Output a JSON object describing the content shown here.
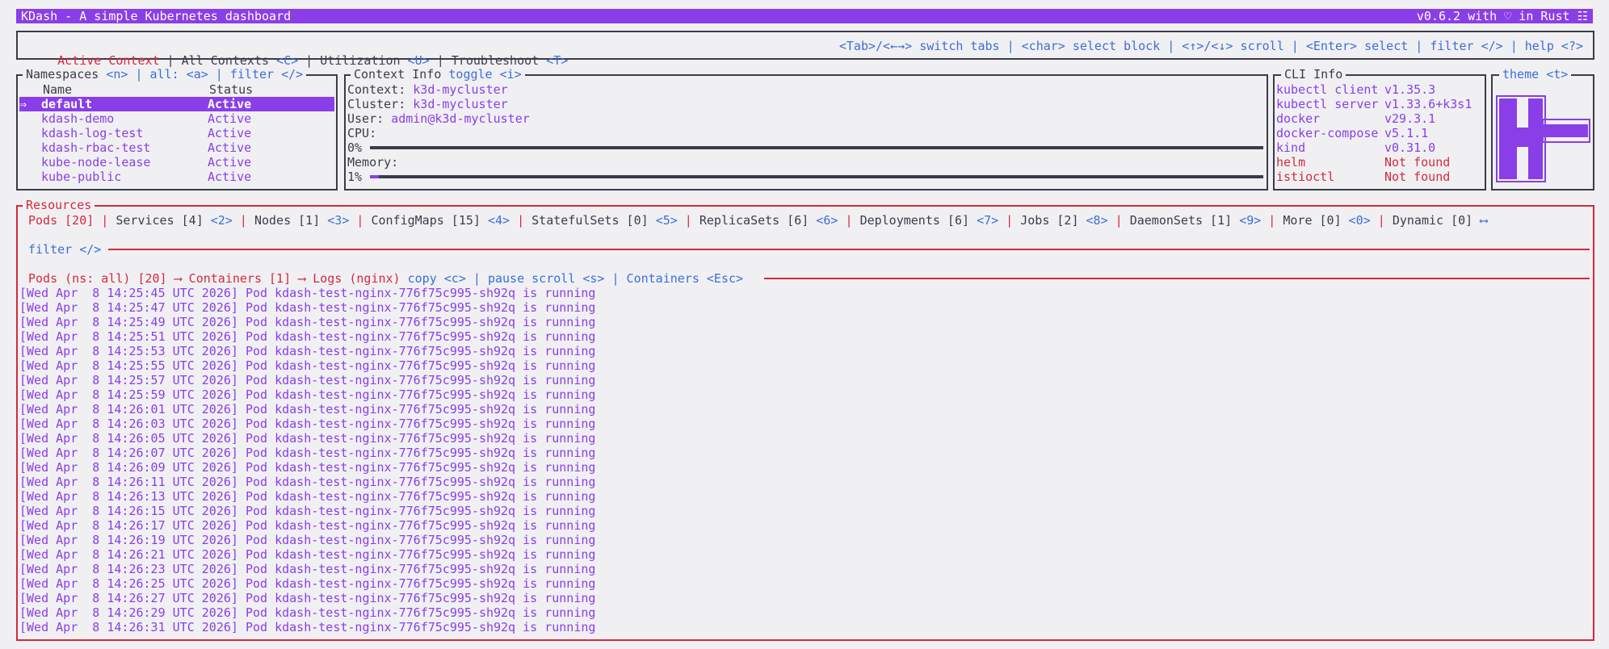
{
  "titlebar": {
    "title": "KDash - A simple Kubernetes dashboard",
    "version": "v0.6.2 with ♡ in Rust ☷"
  },
  "top_tabs": [
    {
      "label": "Active Context",
      "key": ""
    },
    {
      "label": "All Contexts",
      "key": "<C>"
    },
    {
      "label": "Utilization",
      "key": "<U>"
    },
    {
      "label": "Troubleshoot",
      "key": "<T>"
    }
  ],
  "help_bar": "<Tab>/<←→> switch tabs | <char> select block | <↑>/<↓> scroll | <Enter> select | filter </> | help <?>",
  "namespaces": {
    "title": "Namespaces",
    "key_n": "<n>",
    "all_label": "all:",
    "key_a": "<a>",
    "filter_label": "filter",
    "key_filter": "</>",
    "col_name": "Name",
    "col_status": "Status",
    "selected_marker": "⇒",
    "rows": [
      {
        "name": "default",
        "status": "Active"
      },
      {
        "name": "kdash-demo",
        "status": "Active"
      },
      {
        "name": "kdash-log-test",
        "status": "Active"
      },
      {
        "name": "kdash-rbac-test",
        "status": "Active"
      },
      {
        "name": "kube-node-lease",
        "status": "Active"
      },
      {
        "name": "kube-public",
        "status": "Active"
      }
    ]
  },
  "context_info": {
    "title": "Context Info",
    "toggle_label": "toggle",
    "key_i": "<i>",
    "context_label": "Context:",
    "context_value": "k3d-mycluster",
    "cluster_label": "Cluster:",
    "cluster_value": "k3d-mycluster",
    "user_label": "User:",
    "user_value": "admin@k3d-mycluster",
    "cpu_label": "CPU:",
    "cpu_value": "0%",
    "cpu_fraction": 0.0,
    "memory_label": "Memory:",
    "memory_value": "1%",
    "memory_fraction": 0.01
  },
  "cli_info": {
    "title": "CLI Info",
    "rows": [
      {
        "name": "kubectl client",
        "version": "v1.35.3",
        "found": true
      },
      {
        "name": "kubectl server",
        "version": "v1.33.6+k3s1",
        "found": true
      },
      {
        "name": "docker",
        "version": "v29.3.1",
        "found": true
      },
      {
        "name": "docker-compose",
        "version": "v5.1.1",
        "found": true
      },
      {
        "name": "kind",
        "version": "v0.31.0",
        "found": true
      },
      {
        "name": "helm",
        "version": "Not found",
        "found": false
      },
      {
        "name": "istioctl",
        "version": "Not found",
        "found": false
      }
    ]
  },
  "theme": {
    "title": "theme",
    "key": "<t>"
  },
  "resources": {
    "title": "Resources",
    "tabs": [
      {
        "label": "Pods [20]",
        "key": ""
      },
      {
        "label": "Services [4]",
        "key": "<2>"
      },
      {
        "label": "Nodes [1]",
        "key": "<3>"
      },
      {
        "label": "ConfigMaps [15]",
        "key": "<4>"
      },
      {
        "label": "StatefulSets [0]",
        "key": "<5>"
      },
      {
        "label": "ReplicaSets [6]",
        "key": "<6>"
      },
      {
        "label": "Deployments [6]",
        "key": "<7>"
      },
      {
        "label": "Jobs [2]",
        "key": "<8>"
      },
      {
        "label": "DaemonSets [1]",
        "key": "<9>"
      },
      {
        "label": "More [0]",
        "key": "<0>"
      },
      {
        "label": "Dynamic [0]",
        "key": "⟷"
      }
    ],
    "filter_label": "filter",
    "filter_key": "</>"
  },
  "logs": {
    "breadcrumb": "Pods (ns: all) [20] ⟶ Containers [1] ⟶ Logs (nginx)",
    "copy_label": "copy",
    "copy_key": "<c>",
    "pause_label": "pause scroll",
    "pause_key": "<s>",
    "containers_label": "Containers",
    "containers_key": "<Esc>",
    "lines": [
      "[Wed Apr  8 14:25:45 UTC 2026] Pod kdash-test-nginx-776f75c995-sh92q is running",
      "[Wed Apr  8 14:25:47 UTC 2026] Pod kdash-test-nginx-776f75c995-sh92q is running",
      "[Wed Apr  8 14:25:49 UTC 2026] Pod kdash-test-nginx-776f75c995-sh92q is running",
      "[Wed Apr  8 14:25:51 UTC 2026] Pod kdash-test-nginx-776f75c995-sh92q is running",
      "[Wed Apr  8 14:25:53 UTC 2026] Pod kdash-test-nginx-776f75c995-sh92q is running",
      "[Wed Apr  8 14:25:55 UTC 2026] Pod kdash-test-nginx-776f75c995-sh92q is running",
      "[Wed Apr  8 14:25:57 UTC 2026] Pod kdash-test-nginx-776f75c995-sh92q is running",
      "[Wed Apr  8 14:25:59 UTC 2026] Pod kdash-test-nginx-776f75c995-sh92q is running",
      "[Wed Apr  8 14:26:01 UTC 2026] Pod kdash-test-nginx-776f75c995-sh92q is running",
      "[Wed Apr  8 14:26:03 UTC 2026] Pod kdash-test-nginx-776f75c995-sh92q is running",
      "[Wed Apr  8 14:26:05 UTC 2026] Pod kdash-test-nginx-776f75c995-sh92q is running",
      "[Wed Apr  8 14:26:07 UTC 2026] Pod kdash-test-nginx-776f75c995-sh92q is running",
      "[Wed Apr  8 14:26:09 UTC 2026] Pod kdash-test-nginx-776f75c995-sh92q is running",
      "[Wed Apr  8 14:26:11 UTC 2026] Pod kdash-test-nginx-776f75c995-sh92q is running",
      "[Wed Apr  8 14:26:13 UTC 2026] Pod kdash-test-nginx-776f75c995-sh92q is running",
      "[Wed Apr  8 14:26:15 UTC 2026] Pod kdash-test-nginx-776f75c995-sh92q is running",
      "[Wed Apr  8 14:26:17 UTC 2026] Pod kdash-test-nginx-776f75c995-sh92q is running",
      "[Wed Apr  8 14:26:19 UTC 2026] Pod kdash-test-nginx-776f75c995-sh92q is running",
      "[Wed Apr  8 14:26:21 UTC 2026] Pod kdash-test-nginx-776f75c995-sh92q is running",
      "[Wed Apr  8 14:26:23 UTC 2026] Pod kdash-test-nginx-776f75c995-sh92q is running",
      "[Wed Apr  8 14:26:25 UTC 2026] Pod kdash-test-nginx-776f75c995-sh92q is running",
      "[Wed Apr  8 14:26:27 UTC 2026] Pod kdash-test-nginx-776f75c995-sh92q is running",
      "[Wed Apr  8 14:26:29 UTC 2026] Pod kdash-test-nginx-776f75c995-sh92q is running",
      "[Wed Apr  8 14:26:31 UTC 2026] Pod kdash-test-nginx-776f75c995-sh92q is running"
    ]
  },
  "colors": {
    "accent": "#8a3ee8",
    "link": "#3a6fd8",
    "error": "#d42a3c",
    "text": "#3c3c48",
    "background": "#f0f0f3"
  }
}
